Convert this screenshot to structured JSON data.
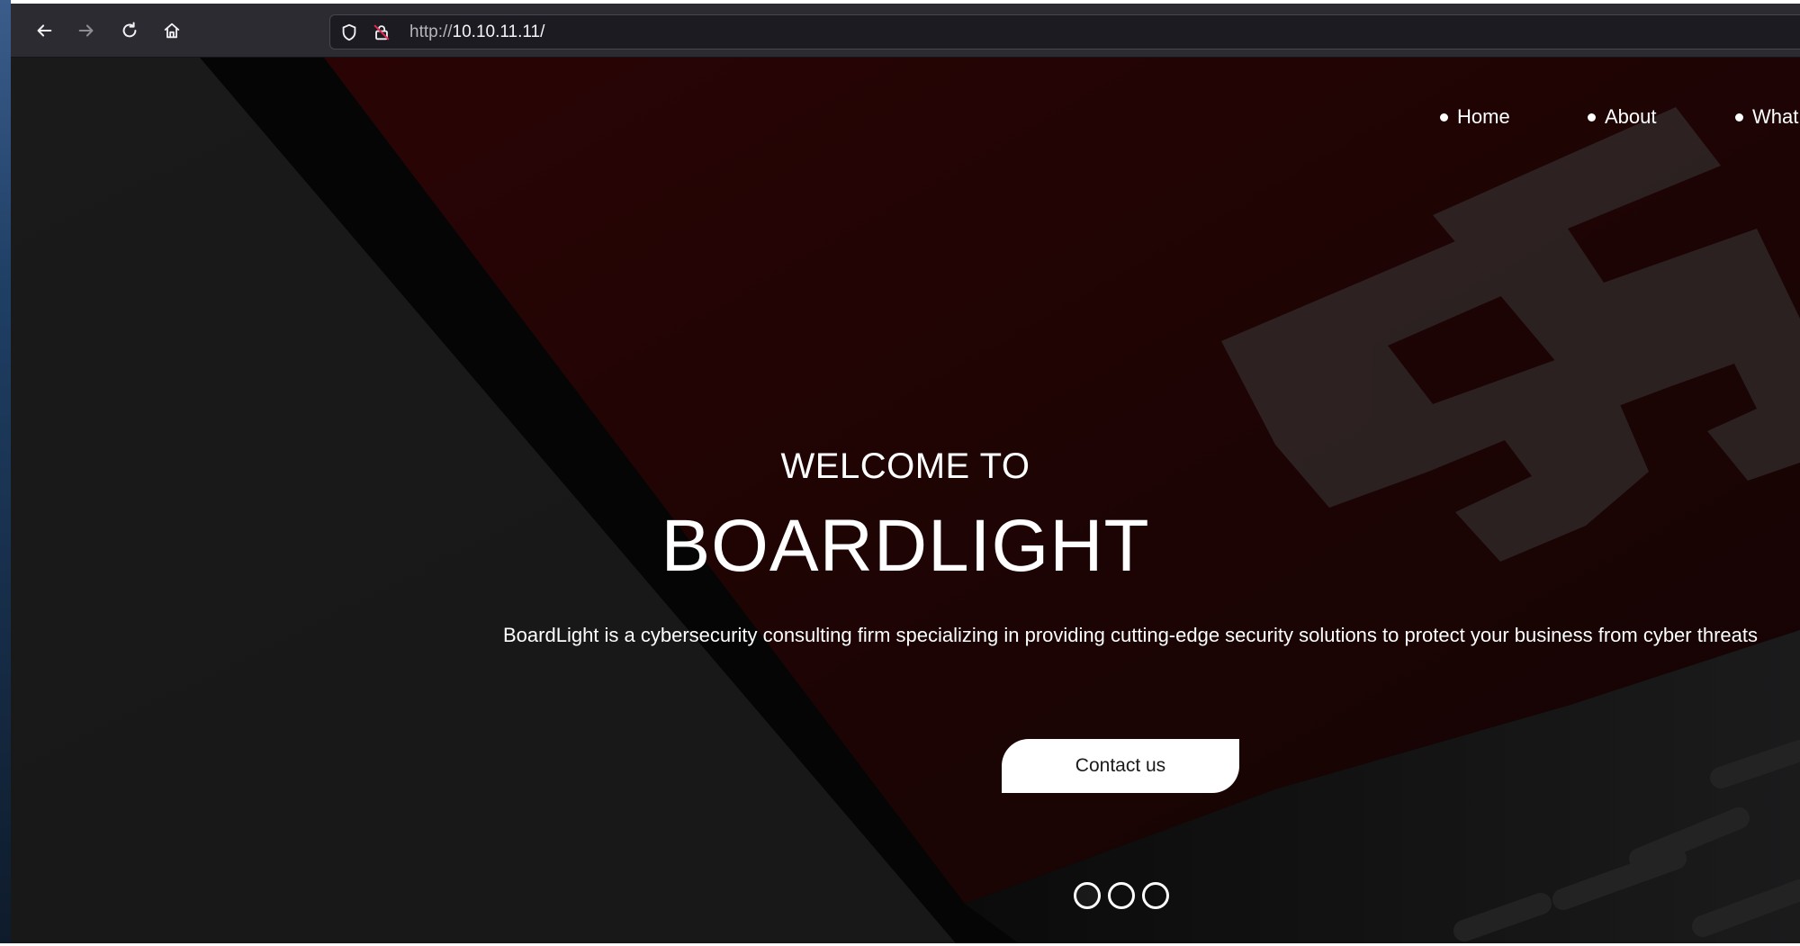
{
  "browser": {
    "url_protocol": "http://",
    "url_host": "10.10.11.11/",
    "icons": {
      "back": "back-arrow-icon",
      "forward": "forward-arrow-icon",
      "reload": "reload-icon",
      "home": "home-icon",
      "shield": "tracking-shield-icon",
      "lock": "insecure-lock-icon"
    }
  },
  "site": {
    "nav": [
      {
        "label": "Home"
      },
      {
        "label": "About"
      },
      {
        "label": "What"
      }
    ],
    "hero": {
      "welcome": "WELCOME TO",
      "brand": "BOARDLIGHT",
      "description": "BoardLight is a cybersecurity consulting firm specializing in providing cutting-edge security solutions to protect your business from cyber threats",
      "cta_label": "Contact us",
      "slide_count": 3
    }
  },
  "colors": {
    "toolbar": "#2b2b31",
    "urlbar": "#1c1b22",
    "hero_left": "#181818",
    "hero_red": "#220405",
    "text": "#ffffff"
  }
}
